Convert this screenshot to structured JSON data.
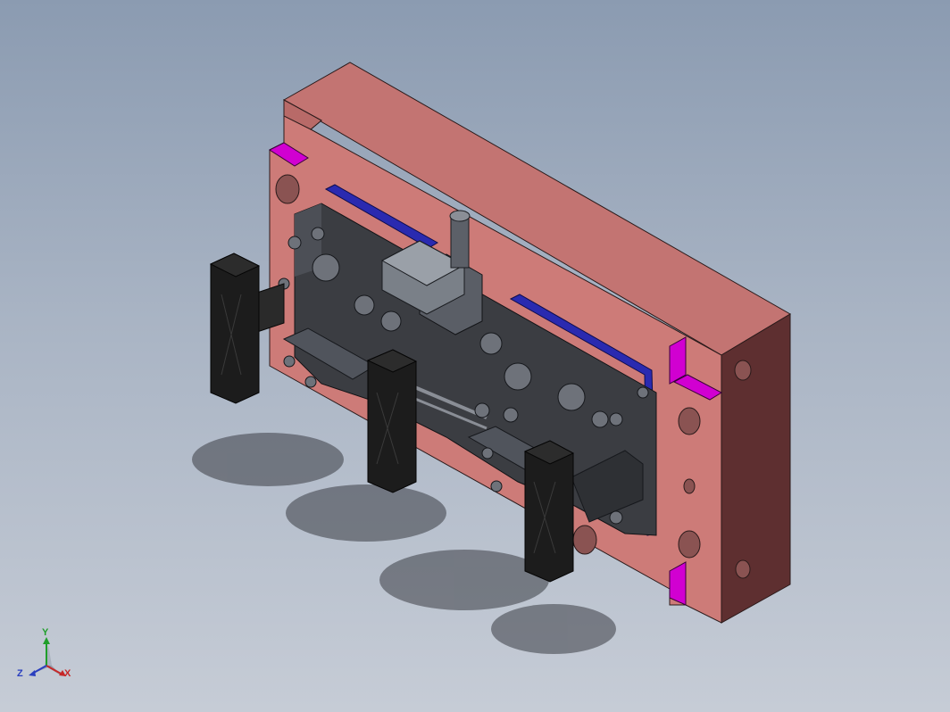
{
  "viewport": {
    "background_top": "#8b9bb1",
    "background_bottom": "#c6ccd6"
  },
  "model": {
    "plate_color": "#cd7b78",
    "plate_shadow_color": "#5e2f30",
    "pocket_color": "#d100d1",
    "backplate_color": "#2a2ab0",
    "fixture_color": "#3b3d42",
    "clamp_pad_color": "#1c1c1c",
    "clamp_pad_count": 3
  },
  "triad": {
    "x_label": "X",
    "y_label": "Y",
    "z_label": "Z",
    "x_color": "#c62828",
    "y_color": "#1f9e2a",
    "z_color": "#2a3fbf"
  }
}
